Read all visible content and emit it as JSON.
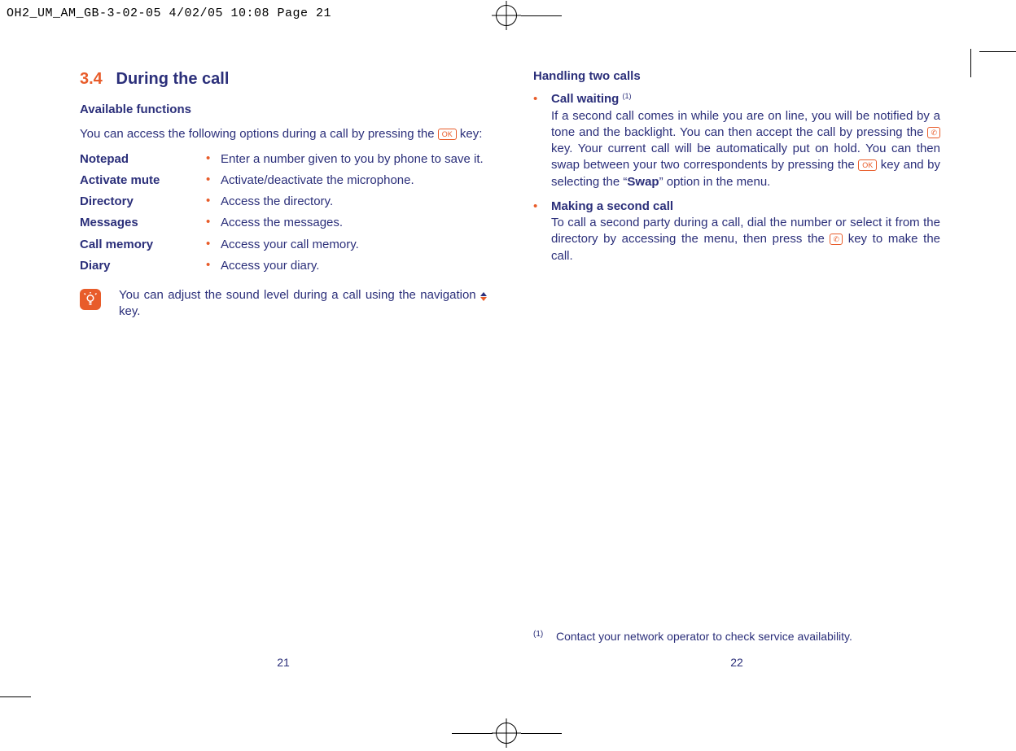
{
  "header_slug": "OH2_UM_AM_GB-3-02-05  4/02/05  10:08  Page 21",
  "left": {
    "sec_num": "3.4",
    "sec_title": "During the call",
    "sub1": "Available functions",
    "intro_a": "You can access the following options during a call by pressing the ",
    "intro_b": " key:",
    "opts": [
      {
        "term": "Notepad",
        "desc": "Enter a number given to you by phone to save it."
      },
      {
        "term": "Activate mute",
        "desc": "Activate/deactivate the microphone."
      },
      {
        "term": "Directory",
        "desc": "Access the directory."
      },
      {
        "term": "Messages",
        "desc": "Access the messages."
      },
      {
        "term": "Call memory",
        "desc": "Access your call memory."
      },
      {
        "term": "Diary",
        "desc": "Access your diary."
      }
    ],
    "tip_a": "You can adjust the sound level during a call using the navigation ",
    "tip_b": " key.",
    "pagenum": "21"
  },
  "right": {
    "sub1": "Handling two calls",
    "cw_lead": "Call waiting ",
    "cw_sup": "(1)",
    "cw_a": "If a second call comes in while you are on line, you will be notified by a tone and the backlight. You can then accept the call by pressing the ",
    "cw_b": " key. Your current call will be automatically put on hold. You can then swap between your two correspondents by pressing the ",
    "cw_c": " key and by selecting the “",
    "cw_swap": "Swap",
    "cw_d": "” option in the menu.",
    "mk_lead": "Making a second call",
    "mk_a": "To call a second party during a call, dial the number or select it from the directory by accessing the menu, then press the ",
    "mk_b": " key to make the call.",
    "fn_mark": "(1)",
    "fn_text": "Contact your network operator to check service availability.",
    "pagenum": "22"
  },
  "ok_label": "OK",
  "call_glyph": "✆"
}
